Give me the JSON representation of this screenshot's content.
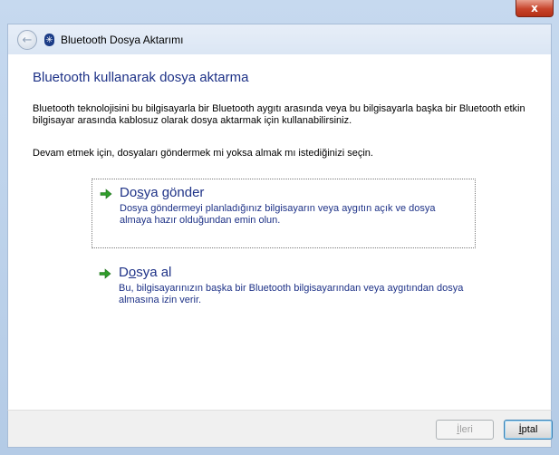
{
  "window": {
    "title": "Bluetooth Dosya Aktarımı",
    "close_label": "x"
  },
  "icons": {
    "back": "back-arrow-icon",
    "bluetooth": "bluetooth-icon",
    "option_arrow": "green-arrow-icon"
  },
  "main": {
    "heading": "Bluetooth kullanarak dosya aktarma",
    "description": "Bluetooth teknolojisini bu bilgisayarla bir Bluetooth aygıtı arasında veya bu bilgisayarla başka bir Bluetooth etkin bilgisayar arasında kablosuz olarak dosya aktarmak için kullanabilirsiniz.",
    "prompt": "Devam etmek için, dosyaları göndermek mi yoksa almak mı istediğinizi seçin."
  },
  "options": [
    {
      "title_pre": "Do",
      "title_u": "s",
      "title_post": "ya gönder",
      "subtitle": "Dosya göndermeyi planladığınız bilgisayarın veya aygıtın açık ve dosya almaya hazır olduğundan emin olun."
    },
    {
      "title_pre": "D",
      "title_u": "o",
      "title_post": "sya al",
      "subtitle": "Bu, bilgisayarınızın başka bir Bluetooth bilgisayarından veya aygıtından dosya almasına izin verir."
    }
  ],
  "footer": {
    "next_u": "İ",
    "next_rest": "leri",
    "cancel_u": "İ",
    "cancel_rest": "ptal"
  },
  "colors": {
    "accent_text": "#1e3287",
    "arrow_green": "#2f9d2a",
    "close_red": "#c7442b"
  }
}
